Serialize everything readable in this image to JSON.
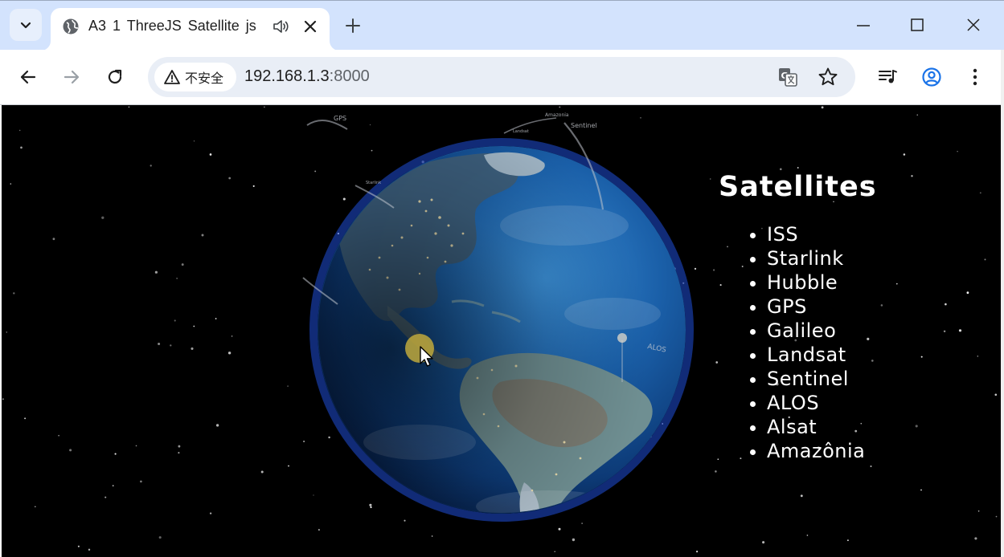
{
  "browser": {
    "tab": {
      "title": "A3 1 ThreeJS Satellite js",
      "favicon": "globe-icon",
      "audio": "speaker-icon",
      "close": "close-icon"
    },
    "new_tab": "plus-icon",
    "window_controls": [
      "minimize-icon",
      "maximize-icon",
      "close-icon"
    ],
    "nav": [
      "back-arrow-icon",
      "forward-arrow-icon",
      "reload-icon"
    ],
    "omnibox": {
      "security_label": "不安全",
      "url_host": "192.168.1.3",
      "url_port": ":8000"
    },
    "toolbar_right": [
      "translate-icon",
      "star-icon",
      "media-queue-icon",
      "profile-icon",
      "kebab-menu-icon"
    ]
  },
  "page": {
    "background": "#000000",
    "globe_labels": [
      "GPS",
      "Amazonia",
      "Sentinel",
      "Landsat",
      "Starlink",
      "ALOS"
    ],
    "panel": {
      "title": "Satellites",
      "satellites": [
        "ISS",
        "Starlink",
        "Hubble",
        "GPS",
        "Galileo",
        "Landsat",
        "Sentinel",
        "ALOS",
        "Alsat",
        "Amazônia"
      ]
    }
  },
  "colors": {
    "tabstrip": "#d3e3fd",
    "omnibox": "#e9eef6",
    "ocean": "#1a5fa8",
    "atmosphere": "#2a5fff",
    "cursor_highlight": "#bea83c"
  }
}
